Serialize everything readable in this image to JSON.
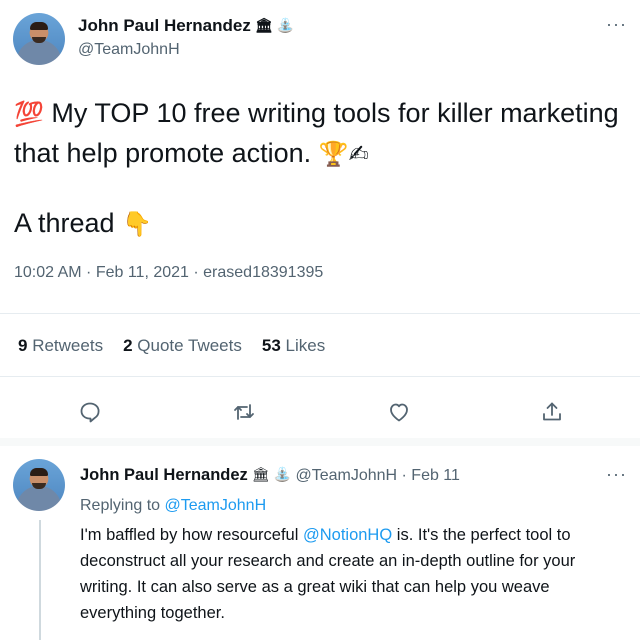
{
  "main_tweet": {
    "author_name": "John Paul Hernandez",
    "badge_emojis": [
      "🏛",
      "⛲"
    ],
    "handle": "@TeamJohnH",
    "text_emoji_start": "💯",
    "text": "My TOP 10 free writing tools for killer marketing that help promote action.",
    "text_emojis_end": [
      "🏆",
      "✍"
    ],
    "thread_text": "A thread",
    "thread_emoji": "👇",
    "meta": "10:02 AM · Feb 11, 2021 · erased18391395",
    "stats": {
      "retweets_count": "9",
      "retweets_label": "Retweets",
      "quote_count": "2",
      "quote_label": "Quote Tweets",
      "likes_count": "53",
      "likes_label": "Likes"
    },
    "actions": [
      "reply-icon",
      "retweet-icon",
      "like-icon",
      "share-icon"
    ]
  },
  "reply_tweet": {
    "author_name": "John Paul Hernandez",
    "badge_emojis": [
      "🏛",
      "⛲"
    ],
    "handle_date": "@TeamJohnH · Feb 11",
    "replying_prefix": "Replying to",
    "replying_handle": "@TeamJohnH",
    "text_before": "I'm baffled by how resourceful",
    "mention": "@NotionHQ",
    "text_after": "is. It's the perfect tool to deconstruct all your research and create an in-depth outline for your writing. It can also serve as a great wiki that can help you weave everything together."
  },
  "more_label": "···",
  "colors": {
    "link": "#1d9bf0",
    "text_primary": "#0f1419",
    "text_secondary": "#536471",
    "divider": "#e6ecf0"
  }
}
